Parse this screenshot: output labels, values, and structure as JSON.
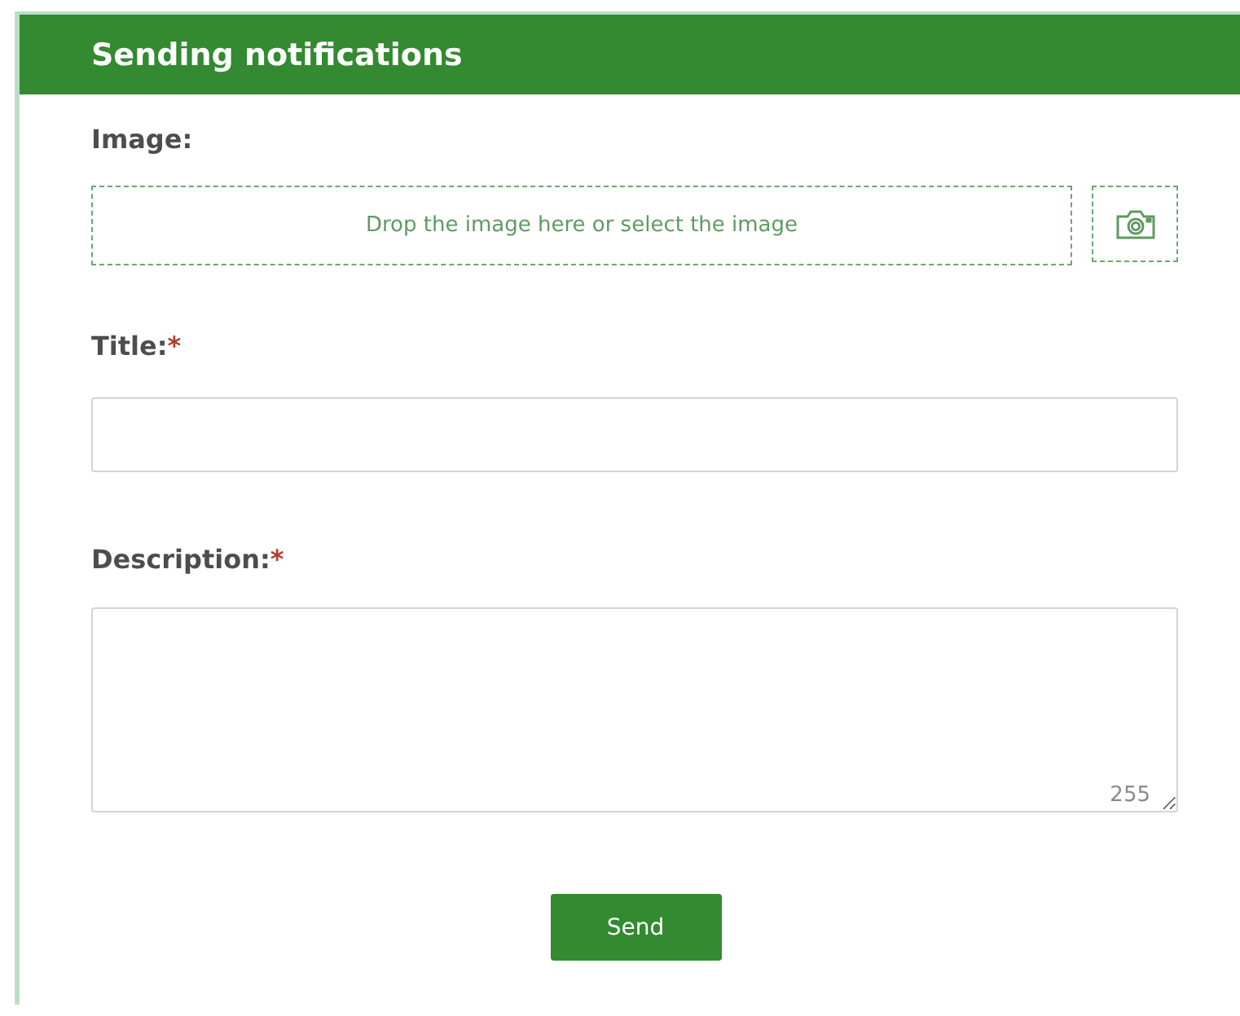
{
  "header": {
    "title": "Sending notifications"
  },
  "image": {
    "label": "Image:",
    "drop_text": "Drop the image here or select the image"
  },
  "fields": [
    {
      "kind": "input",
      "label": "Title:",
      "required_mark": "*"
    },
    {
      "kind": "textarea",
      "label": "Description:",
      "required_mark": "*",
      "counter": "255"
    }
  ],
  "send_button": "Send"
}
